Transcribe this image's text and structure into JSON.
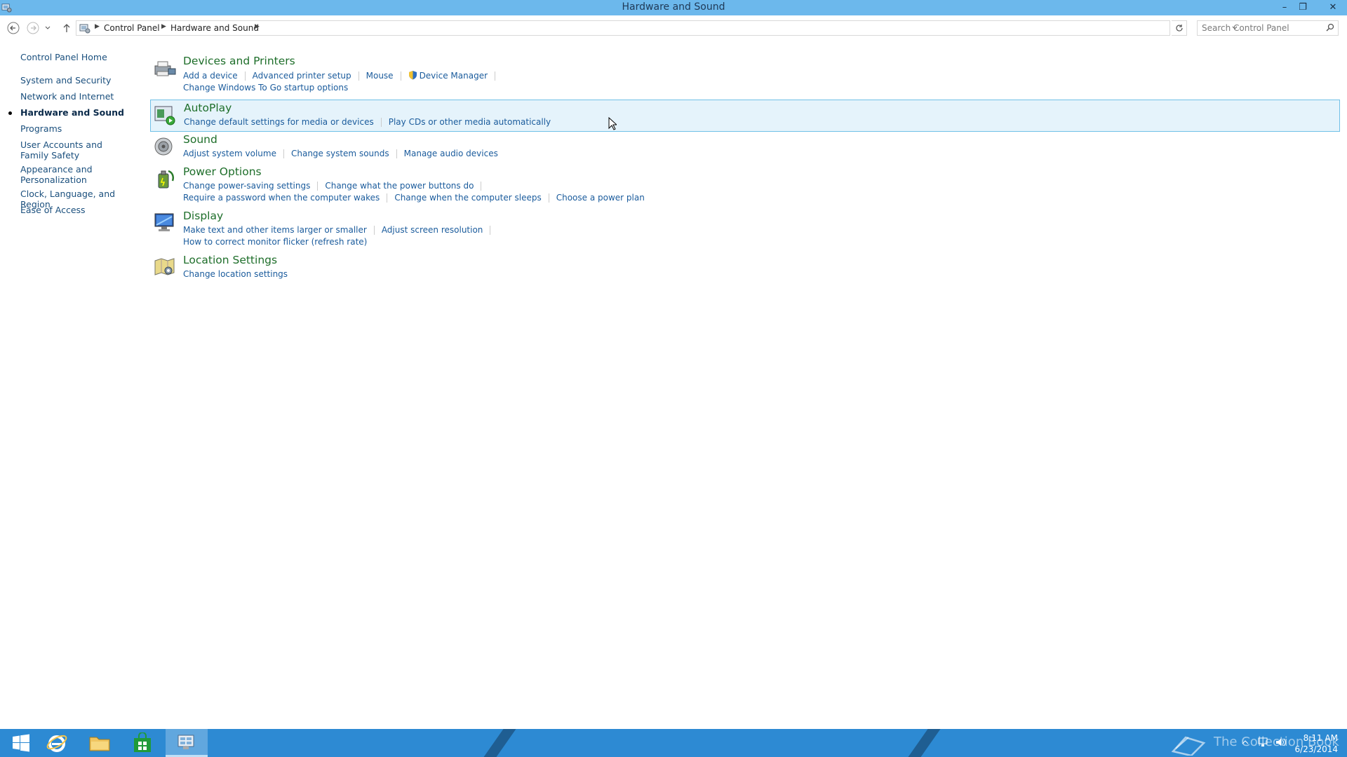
{
  "window": {
    "title": "Hardware and Sound",
    "controls": {
      "minimize": "–",
      "maximize": "❐",
      "close": "✕"
    }
  },
  "address": {
    "breadcrumbs": [
      "Control Panel",
      "Hardware and Sound"
    ],
    "search_placeholder": "Search Control Panel"
  },
  "sidebar": {
    "items": [
      {
        "label": "Control Panel Home"
      },
      {
        "label": "System and Security"
      },
      {
        "label": "Network and Internet"
      },
      {
        "label": "Hardware and Sound",
        "active": true
      },
      {
        "label": "Programs"
      },
      {
        "label": "User Accounts and Family Safety"
      },
      {
        "label": "Appearance and Personalization"
      },
      {
        "label": "Clock, Language, and Region"
      },
      {
        "label": "Ease of Access"
      }
    ]
  },
  "groups": {
    "devices": {
      "title": "Devices and Printers",
      "links": [
        "Add a device",
        "Advanced printer setup",
        "Mouse",
        "Device Manager",
        "Change Windows To Go startup options"
      ]
    },
    "autoplay": {
      "title": "AutoPlay",
      "links": [
        "Change default settings for media or devices",
        "Play CDs or other media automatically"
      ]
    },
    "sound": {
      "title": "Sound",
      "links": [
        "Adjust system volume",
        "Change system sounds",
        "Manage audio devices"
      ]
    },
    "power": {
      "title": "Power Options",
      "links": [
        "Change power-saving settings",
        "Change what the power buttons do",
        "Require a password when the computer wakes",
        "Change when the computer sleeps",
        "Choose a power plan"
      ]
    },
    "display": {
      "title": "Display",
      "links": [
        "Make text and other items larger or smaller",
        "Adjust screen resolution",
        "How to correct monitor flicker (refresh rate)"
      ]
    },
    "location": {
      "title": "Location Settings",
      "links": [
        "Change location settings"
      ]
    }
  },
  "taskbar": {
    "brand": "The Collection Book",
    "time": "8:11 AM",
    "date": "6/23/2014"
  },
  "colors": {
    "titlebar": "#6cb8ec",
    "taskbar": "#2d8ad3",
    "group_title": "#1e6e2a",
    "link": "#1a5b9c"
  }
}
